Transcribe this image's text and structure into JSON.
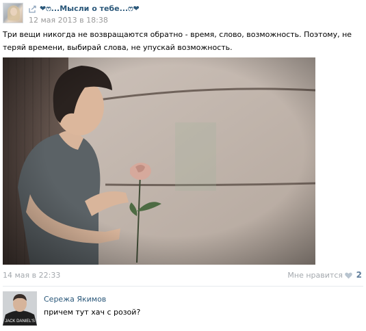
{
  "post": {
    "group_name": "❤ෆ...Мысли о тебе...ෆ❤",
    "date": "12 мая 2013 в 18:38",
    "text": "Три вещи никогда не возвращаются обратно - время, слово, возможность. Поэтому, не теряй времени, выбирай слова, не упускай возможность.",
    "icons": {
      "repost": "repost-arrow-icon",
      "like": "heart-icon"
    }
  },
  "meta": {
    "date": "14 мая в 22:33",
    "like_label": "Мне нравится",
    "like_count": "2"
  },
  "comment": {
    "author": "Сережа Якимов",
    "text": "причем тут хач с розой?",
    "avatar_shirt_text": "JACK DANIEL'S"
  },
  "colors": {
    "link": "#2b587a",
    "muted": "#999999",
    "like_count": "#5f7d9b",
    "divider": "#e7eaed"
  }
}
